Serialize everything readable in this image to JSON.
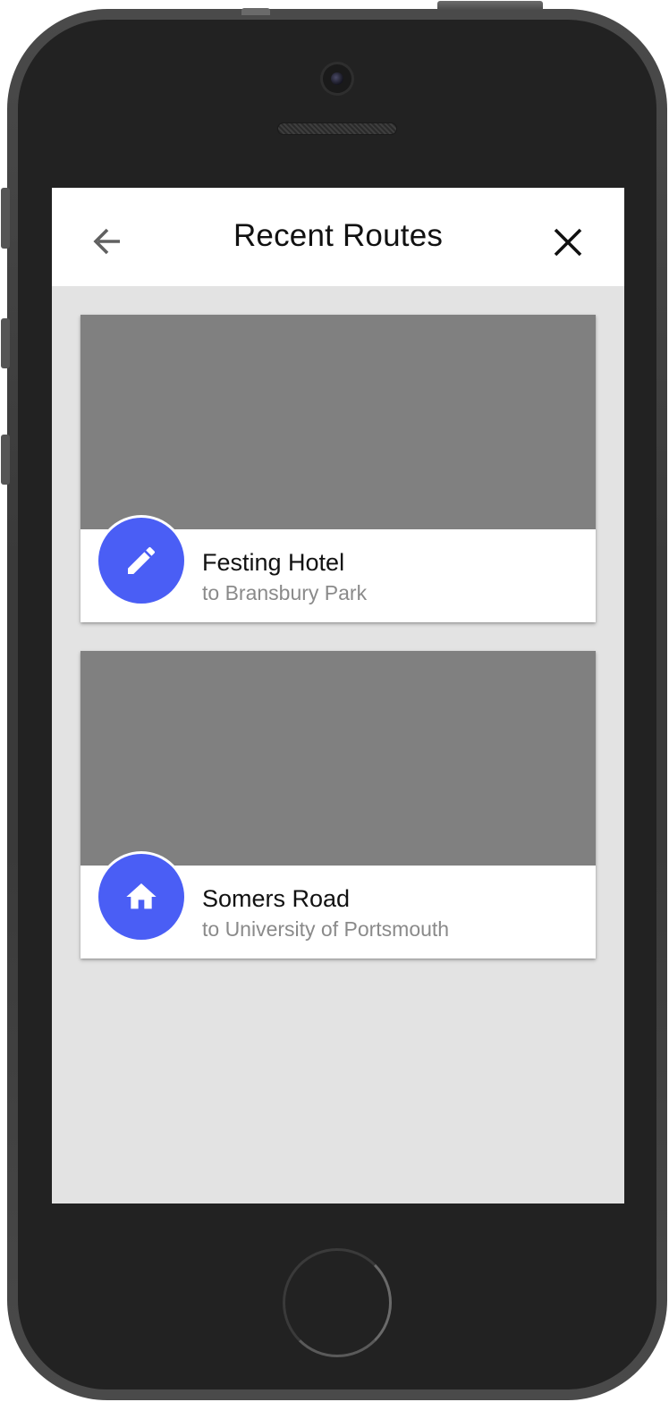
{
  "header": {
    "title": "Recent Routes",
    "back_icon": "arrow-left-icon",
    "close_icon": "close-icon"
  },
  "routes": [
    {
      "title": "Festing Hotel",
      "subtitle": "to Bransbury Park",
      "icon": "pencil-icon"
    },
    {
      "title": "Somers Road",
      "subtitle": "to University of Portsmouth",
      "icon": "home-icon"
    }
  ],
  "colors": {
    "accent": "#4a5ef5",
    "media_placeholder": "#808080",
    "screen_background": "#e3e3e3"
  }
}
